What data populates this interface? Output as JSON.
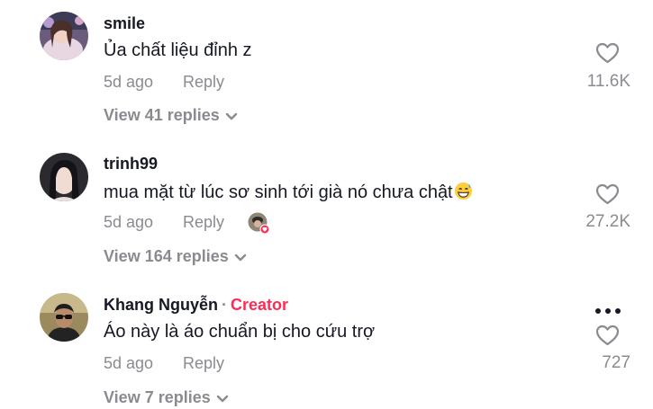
{
  "comments": [
    {
      "username": "smile",
      "text": "Ủa chất liệu đỉnh z",
      "time": "5d ago",
      "reply_label": "Reply",
      "likes": "11.6K",
      "view_replies": "View 41 replies"
    },
    {
      "username": "trinh99",
      "text": "mua mặt từ lúc sơ sinh tới già nó chưa chật",
      "emoji": "grinning-sweat-emoji",
      "time": "5d ago",
      "reply_label": "Reply",
      "liked_by_creator": true,
      "likes": "27.2K",
      "view_replies": "View 164 replies"
    },
    {
      "username": "Khang Nguyễn",
      "separator": "·",
      "badge": "Creator",
      "text": "Áo này là áo chuẩn bị cho cứu trợ",
      "time": "5d ago",
      "reply_label": "Reply",
      "likes": "727",
      "view_replies": "View 7 replies"
    }
  ],
  "icons": {
    "like": "heart-outline-icon",
    "expand": "chevron-down-icon",
    "more": "more-options-icon"
  },
  "colors": {
    "text": "#161823",
    "muted": "#8a8b91",
    "creator": "#fe2c55"
  }
}
